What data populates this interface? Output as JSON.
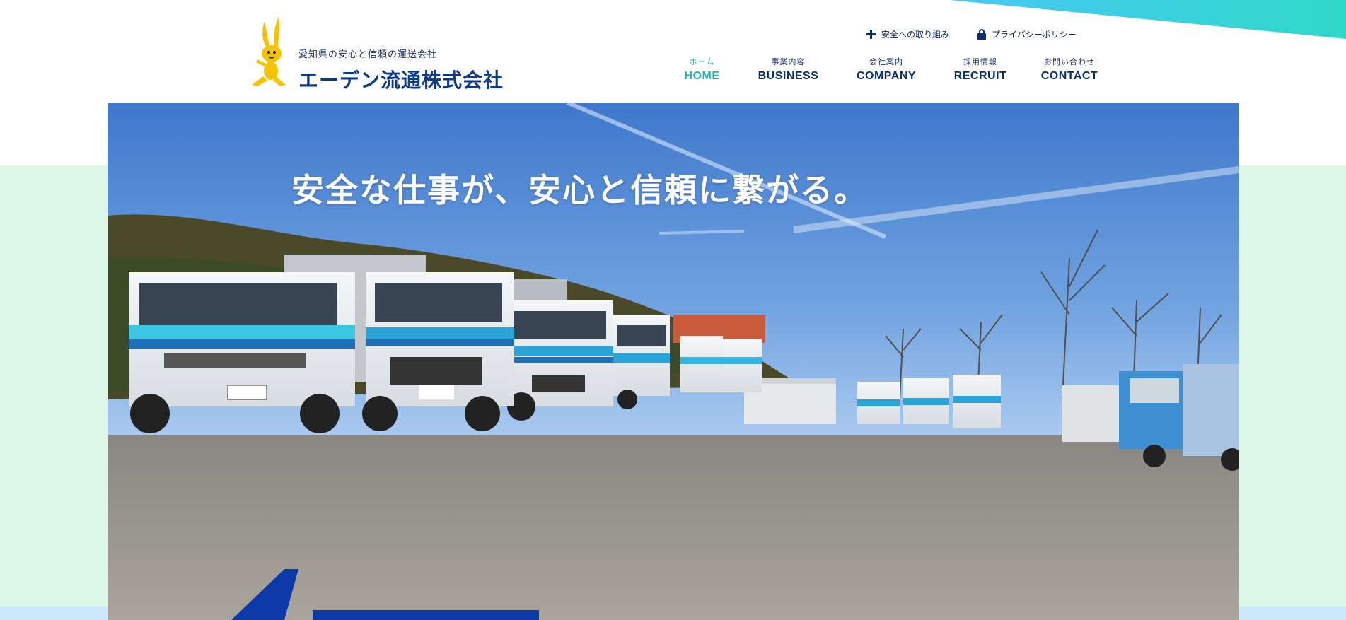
{
  "header": {
    "tagline": "愛知県の安心と信頼の運送会社",
    "company_name": "エーデン流通株式会社",
    "util_links": [
      {
        "label": "安全への取り組み",
        "icon": "plus-icon"
      },
      {
        "label": "プライバシーポリシー",
        "icon": "lock-icon"
      }
    ],
    "nav": [
      {
        "sub": "ホーム",
        "label": "HOME",
        "active": true
      },
      {
        "sub": "事業内容",
        "label": "BUSINESS",
        "active": false
      },
      {
        "sub": "会社案内",
        "label": "COMPANY",
        "active": false
      },
      {
        "sub": "採用情報",
        "label": "RECRUIT",
        "active": false
      },
      {
        "sub": "お問い合わせ",
        "label": "CONTACT",
        "active": false
      }
    ]
  },
  "hero": {
    "headline": "安全な仕事が、安心と信頼に繋がる。",
    "image": "truck-fleet-parking-lot-photo"
  },
  "colors": {
    "accent_teal": "#22b9a8",
    "navy": "#0b2f6e",
    "mint_background": "#dcf7e8",
    "sky_blue": "#5a8fd4"
  }
}
